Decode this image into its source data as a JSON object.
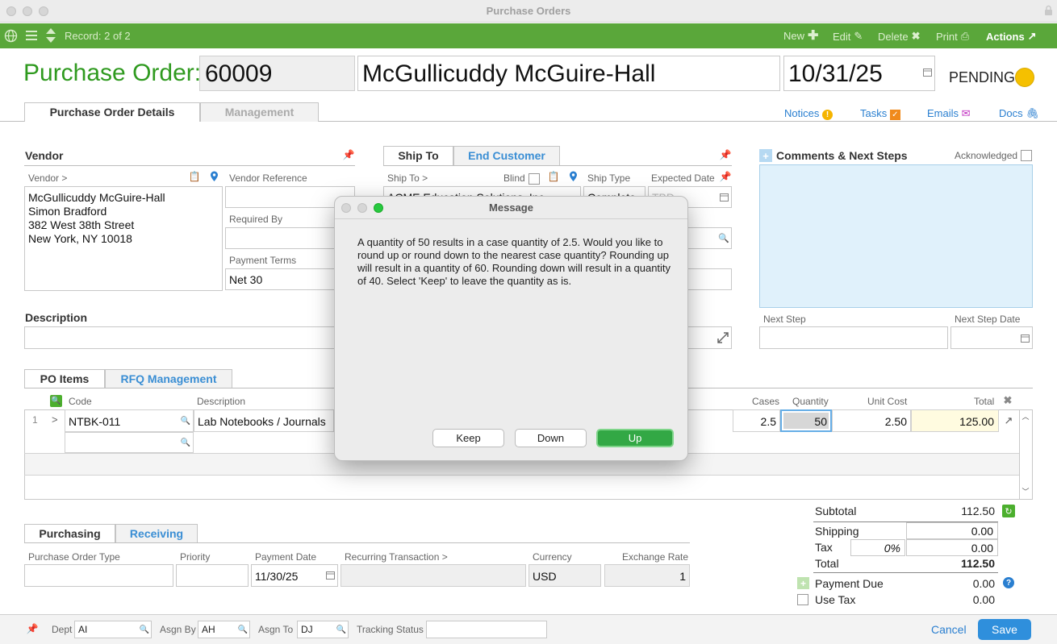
{
  "window": {
    "title": "Purchase Orders"
  },
  "toolbar": {
    "record": "Record: 2 of 2",
    "new": "New",
    "edit": "Edit",
    "delete": "Delete",
    "print": "Print",
    "actions": "Actions"
  },
  "header": {
    "label": "Purchase Order:",
    "po_number": "60009",
    "vendor_name": "McGullicuddy McGuire-Hall",
    "date": "10/31/25",
    "status": "PENDING",
    "status_color": "#f5c000"
  },
  "tabs": {
    "details": "Purchase Order Details",
    "management": "Management"
  },
  "header_links": {
    "notices": "Notices",
    "tasks": "Tasks",
    "emails": "Emails",
    "docs": "Docs"
  },
  "vendor": {
    "section": "Vendor",
    "vendor_label": "Vendor >",
    "address": [
      "McGullicuddy McGuire-Hall",
      "Simon Bradford",
      "382 West 38th Street",
      "New York, NY 10018"
    ],
    "reference_label": "Vendor Reference",
    "required_by_label": "Required By",
    "payment_terms_label": "Payment Terms",
    "payment_terms": "Net 30"
  },
  "ship": {
    "tab_ship_to": "Ship To",
    "tab_end_customer": "End Customer",
    "ship_to_label": "Ship To >",
    "blind_label": "Blind",
    "ship_type_label": "Ship Type",
    "expected_date_label": "Expected Date",
    "ship_to_partial": "ACME Education Solutions, Inc.",
    "ship_type_partial": "Complete",
    "expected_partial": "TBD"
  },
  "comments": {
    "title": "Comments & Next Steps",
    "acknowledged": "Acknowledged",
    "next_step": "Next Step",
    "next_step_date": "Next Step Date"
  },
  "description": {
    "label": "Description"
  },
  "items": {
    "tab_po_items": "PO Items",
    "tab_rfq": "RFQ Management",
    "col_code": "Code",
    "col_description": "Description",
    "col_cases": "Cases",
    "col_quantity": "Quantity",
    "col_unit_cost": "Unit Cost",
    "col_total": "Total",
    "rows": [
      {
        "num": "1",
        "code": "NTBK-011",
        "description": "Lab Notebooks / Journals",
        "cases": "2.5",
        "quantity": "50",
        "unit_cost": "2.50",
        "total": "125.00"
      }
    ]
  },
  "totals": {
    "subtotal_label": "Subtotal",
    "subtotal": "112.50",
    "shipping_label": "Shipping",
    "shipping": "0.00",
    "tax_label": "Tax",
    "tax_rate": "0%",
    "tax": "0.00",
    "total_label": "Total",
    "total": "112.50",
    "payment_due_label": "Payment Due",
    "payment_due": "0.00",
    "use_tax_label": "Use Tax",
    "use_tax": "0.00"
  },
  "purchasing": {
    "tab_purchasing": "Purchasing",
    "tab_receiving": "Receiving",
    "po_type_label": "Purchase Order Type",
    "priority_label": "Priority",
    "payment_date_label": "Payment Date",
    "payment_date": "11/30/25",
    "recurring_label": "Recurring Transaction >",
    "currency_label": "Currency",
    "currency": "USD",
    "exchange_label": "Exchange Rate",
    "exchange": "1"
  },
  "footer": {
    "dept_label": "Dept",
    "dept": "AI",
    "asgn_by_label": "Asgn By",
    "asgn_by": "AH",
    "asgn_to_label": "Asgn To",
    "asgn_to": "DJ",
    "tracking_label": "Tracking Status",
    "cancel": "Cancel",
    "save": "Save"
  },
  "dialog": {
    "title": "Message",
    "message": "A quantity of 50 results in a case quantity of 2.5. Would you like to round up or round down to the nearest case quantity? Rounding up will result in a quantity of 60. Rounding down will result in a quantity of 40. Select 'Keep' to leave the quantity as is.",
    "keep": "Keep",
    "down": "Down",
    "up": "Up"
  },
  "colors": {
    "toolbar_green": "#5aa73a",
    "title_green": "#2f9a1f",
    "link_blue": "#2a7fd0",
    "save_blue": "#2f8fdc"
  }
}
